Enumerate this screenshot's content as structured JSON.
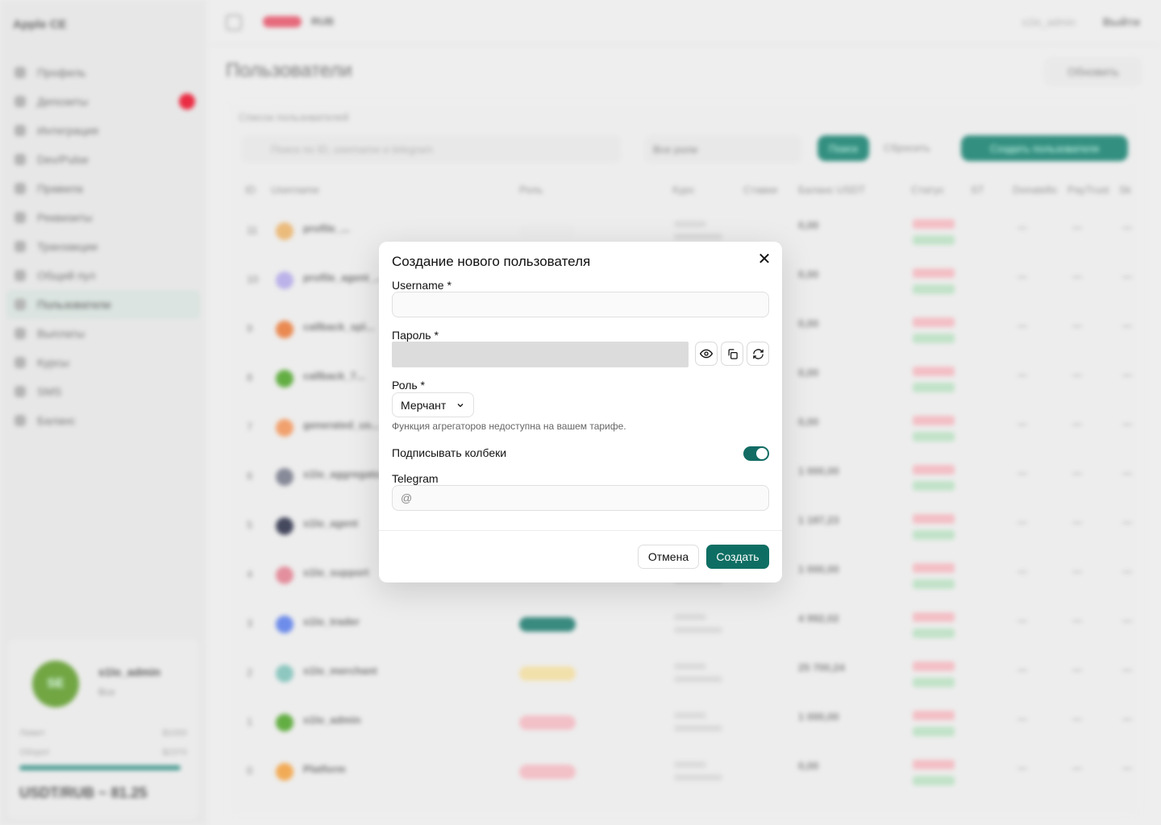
{
  "app": {
    "brand": "Apple CE",
    "topbar": {
      "currency": "RUB",
      "user": "s1lo_admin",
      "logout": "Выйти"
    },
    "sidebar": {
      "items": [
        {
          "label": "Профиль"
        },
        {
          "label": "Депозиты",
          "badge": true
        },
        {
          "label": "Интеграция"
        },
        {
          "label": "Dev/Pulse"
        },
        {
          "label": "Правила"
        },
        {
          "label": "Реквизиты"
        },
        {
          "label": "Транзакции"
        },
        {
          "label": "Общий пул"
        },
        {
          "label": "Пользователи",
          "active": true
        },
        {
          "label": "Выплаты"
        },
        {
          "label": "Курсы"
        },
        {
          "label": "SMS"
        },
        {
          "label": "Баланс"
        }
      ]
    },
    "user_card": {
      "initials": "SE",
      "name": "s1lo_admin",
      "role": "Все",
      "limit_label": "Лимит",
      "limit_value": "$1000",
      "turnover_label": "Оборот",
      "turnover_value": "$2370",
      "rate": "USDT/RUB ~ 81.25"
    },
    "page_title": "Пользователи",
    "refresh_label": "Обновить",
    "list": {
      "title": "Список пользователей",
      "search_placeholder": "Поиск по ID, username и telegram",
      "role_filter": "Все роли",
      "find_button": "Поиск",
      "reset_button": "Сбросить",
      "create_button": "Создать пользователя",
      "columns": [
        "ID",
        "Username",
        "Роль",
        "Курс",
        "Ставки",
        "Баланс USDT",
        "Статус",
        "ST",
        "Donatello",
        "PayTrust",
        "Sk"
      ],
      "rows": [
        {
          "id": "11",
          "username": "profile_...",
          "balance": "0,00",
          "avatar_color": "#e9b26a"
        },
        {
          "id": "10",
          "username": "profile_agent_...",
          "balance": "0,00",
          "avatar_color": "#b2a8e6"
        },
        {
          "id": "9",
          "username": "callback_spl...",
          "balance": "0,00",
          "avatar_color": "#e87a3a"
        },
        {
          "id": "8",
          "username": "callback_7...",
          "balance": "0,00",
          "avatar_color": "#4ea32a"
        },
        {
          "id": "7",
          "username": "generated_us...",
          "balance": "0,00",
          "avatar_color": "#f0955a"
        },
        {
          "id": "6",
          "username": "s1lo_aggregato...",
          "balance": "1 000,00",
          "avatar_color": "#777a8a"
        },
        {
          "id": "5",
          "username": "s1lo_agent",
          "balance": "1 187,23",
          "avatar_color": "#2c3048"
        },
        {
          "id": "4",
          "username": "s1lo_support",
          "balance": "1 000,00",
          "avatar_color": "#e08090"
        },
        {
          "id": "3",
          "username": "s1lo_trader",
          "balance": "4 992,02",
          "avatar_color": "#5a7de8"
        },
        {
          "id": "2",
          "username": "s1lo_merchant",
          "balance": "25 700,24",
          "avatar_color": "#7ec0b8"
        },
        {
          "id": "1",
          "username": "s1lo_admin",
          "balance": "1 000,00",
          "avatar_color": "#4ea32a"
        },
        {
          "id": "0",
          "username": "Platform",
          "balance": "0,00",
          "avatar_color": "#f0a040"
        }
      ]
    }
  },
  "dialog": {
    "title": "Создание нового пользователя",
    "username_label": "Username *",
    "username_value": "",
    "password_label": "Пароль *",
    "role_label": "Роль *",
    "role_value": "Мерчант",
    "role_hint": "Функция агрегаторов недоступна на вашем тарифе.",
    "sign_callbacks_label": "Подписывать колбеки",
    "sign_callbacks_on": true,
    "telegram_label": "Telegram",
    "telegram_placeholder": "@",
    "cancel_label": "Отмена",
    "submit_label": "Создать",
    "accent_color": "#0f6e63"
  }
}
